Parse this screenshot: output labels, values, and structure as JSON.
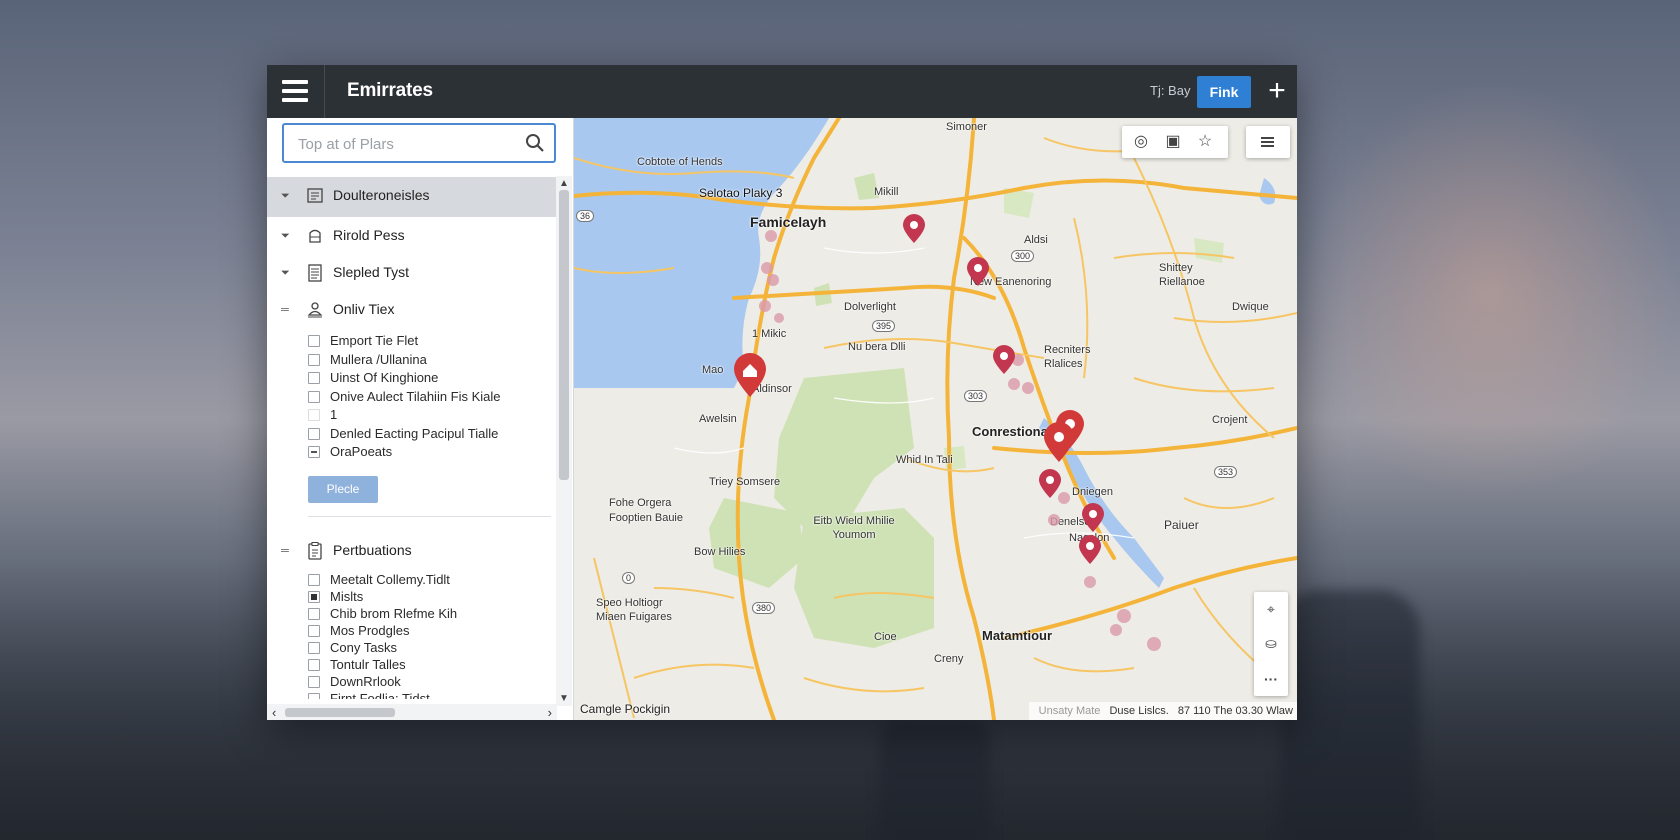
{
  "app": {
    "title": "Emirrates",
    "top_right_text": "Tj: Bay",
    "primary_button": "Fink",
    "plus_label": "+"
  },
  "search": {
    "placeholder": "Top at of Plars"
  },
  "tree": {
    "items": [
      {
        "label": "Doulteroneisles",
        "icon": "document-icon",
        "toggle": "filter-toggle-icon",
        "selected": true
      },
      {
        "label": "Rirold Pess",
        "icon": "server-icon",
        "toggle": "filter-toggle-icon",
        "selected": false
      },
      {
        "label": "Slepled Tyst",
        "icon": "list-document-icon",
        "toggle": "filter-toggle-icon",
        "selected": false
      },
      {
        "label": "Onliv Tiex",
        "icon": "user-stack-icon",
        "toggle": "collapse-toggle-icon",
        "selected": false
      }
    ],
    "group1_checks": [
      {
        "label": "Emport Tie Flet",
        "state": "unchecked"
      },
      {
        "label": "Mullera  /Ullanina",
        "state": "unchecked"
      },
      {
        "label": "Uinst Of Kinghione",
        "state": "unchecked"
      },
      {
        "label": "Onive Aulect Tilahiin Fis Kiale",
        "state": "unchecked"
      },
      {
        "label": "1",
        "state": "unchecked"
      },
      {
        "label": "Denled Eacting Pacipul Tialle",
        "state": "unchecked"
      },
      {
        "label": "OraPoeats",
        "state": "minus"
      }
    ],
    "group1_button": "Plecle",
    "group2": {
      "label": "Pertbuations",
      "icon": "clipboard-icon",
      "toggle": "collapse-toggle-icon"
    },
    "group2_checks": [
      {
        "label": "Meetalt Collemy.Tidlt",
        "state": "unchecked"
      },
      {
        "label": "Mislts",
        "state": "checked"
      },
      {
        "label": "Chib brom Rlefme Kih",
        "state": "unchecked"
      },
      {
        "label": "Mos Prodgles",
        "state": "unchecked"
      },
      {
        "label": "Cony Tasks",
        "state": "unchecked"
      },
      {
        "label": "Tontulr Talles",
        "state": "unchecked"
      },
      {
        "label": "DownRrlook",
        "state": "unchecked"
      },
      {
        "label": "Firnt Fodlia: Tidst",
        "state": "unchecked"
      }
    ]
  },
  "map": {
    "labels": {
      "simoner": "Simoner",
      "cobtote": "Cobtote of Hends",
      "selotao": "Selotao Plaky 3",
      "famicelayh": "Famicelayh",
      "mikill": "Mikill",
      "aldsi": "Aldsi",
      "new_eanenoring": "New Eanenoring",
      "shittey": "Shittey Riellanoe",
      "dwique": "Dwique",
      "dolver": "Dolverlight",
      "mikic": "1 Mikic",
      "nubera": "Nu bera Dlli",
      "recniters": "Recniters Rlalices",
      "mao": "Mao",
      "aldinsor": "Aldinsor",
      "awelsin": "Awelsin",
      "conrestiona": "Conrestiona",
      "crojent": "Crojent",
      "whid": "Whid In Tali",
      "triey": "Triey Somsere",
      "fohe": "Fohe Orgera Fooptien Bauie",
      "dniegen": "Dniegen",
      "denelse": "Denelse",
      "paiuer": "Paiuer",
      "naoclon": "Naoclon",
      "eitb": "Eitb Wield Mhilie Youmom",
      "bow": "Bow Hilies",
      "speo": "Speo Holtiogr Miaen Fuigares",
      "matamtiour": "Matamtiour",
      "cioe": "Cioe",
      "creny": "Creny",
      "r36": "36",
      "r300": "300",
      "r395": "395",
      "r303": "303",
      "r380": "380",
      "r353": "353",
      "r0": "0"
    },
    "footer_left": "Camgle Pockigin",
    "footer_right": [
      "Unsaty Mate",
      "Duse Lislcs.",
      "87 110 The  03.30 Wlaw"
    ],
    "pin_color": "#d23a3a"
  },
  "colors": {
    "topbar": "#2c3136",
    "accent": "#2f7fd4",
    "water": "#a8c8f0",
    "park": "#cfe2b6",
    "road": "#f4b43a"
  }
}
